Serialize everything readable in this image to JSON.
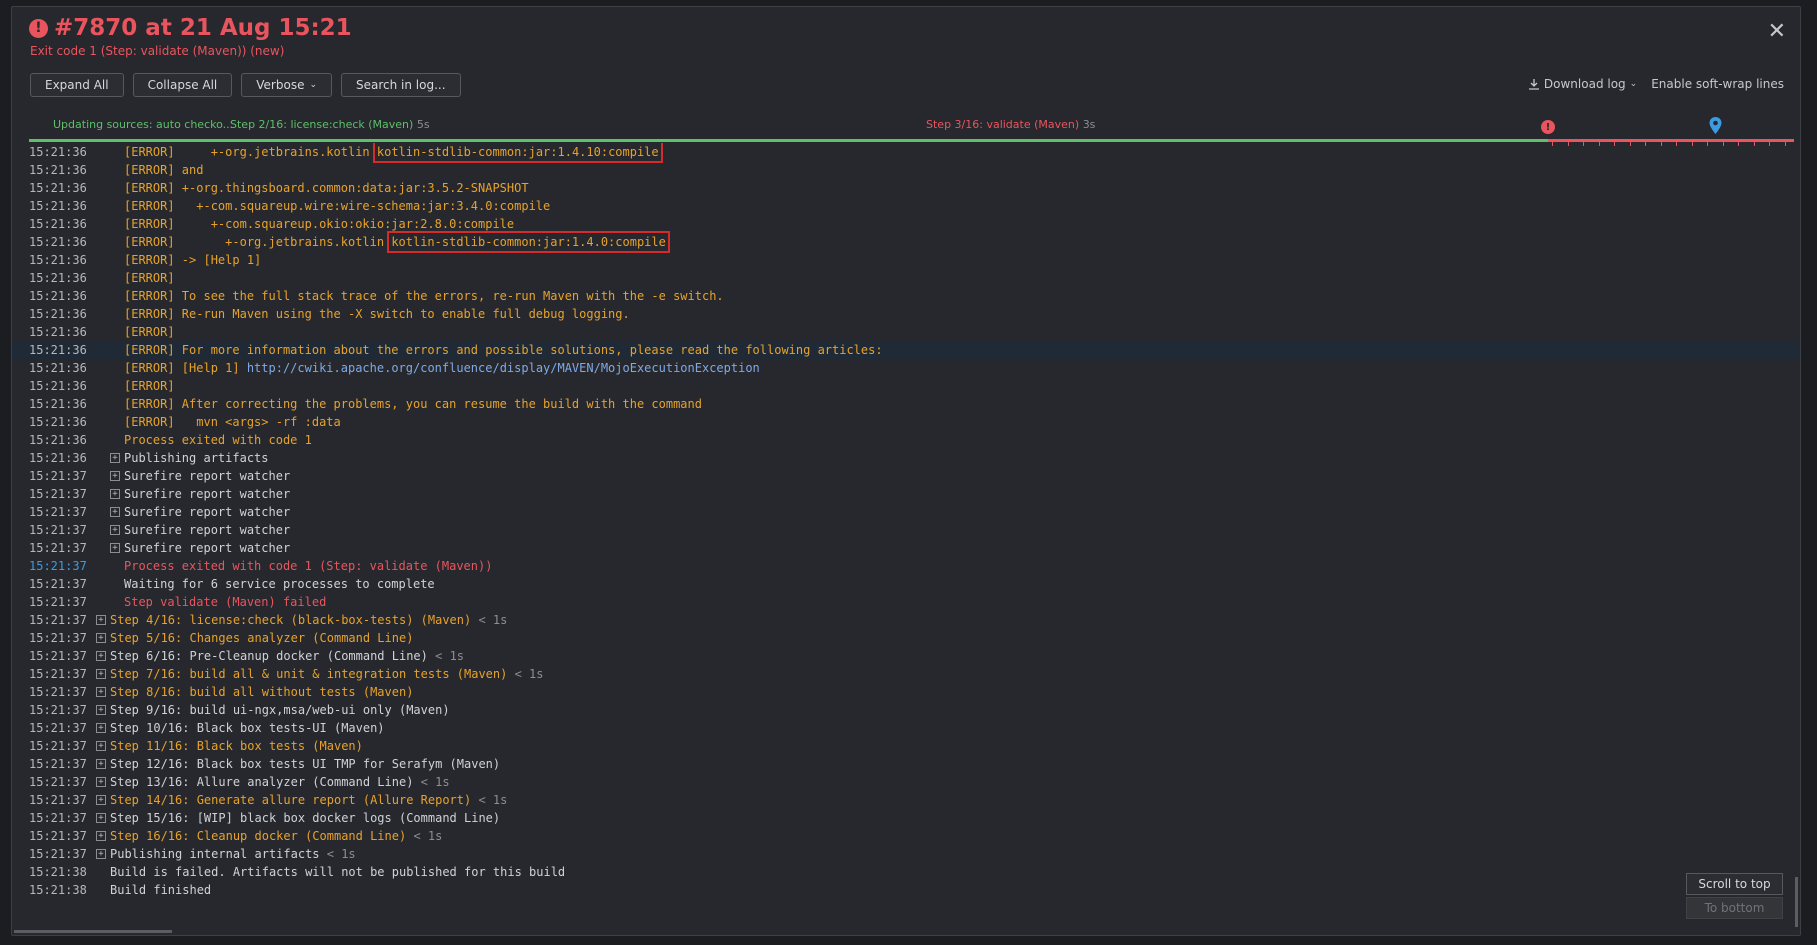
{
  "header": {
    "title": "#7870 at 21 Aug 15:21",
    "subtitle": "Exit code 1 (Step: validate (Maven)) (new)",
    "close": "✕"
  },
  "toolbar": {
    "expand_all": "Expand All",
    "collapse_all": "Collapse All",
    "verbose": "Verbose",
    "search": "Search in log...",
    "download_log": "Download log",
    "soft_wrap": "Enable soft-wrap lines"
  },
  "timeline": {
    "step1": "Updating sources: auto checko...",
    "step2": "Step 2/16: license:check (Maven)",
    "step2_dur": "5s",
    "step3": "Step 3/16: validate (Maven)",
    "step3_dur": "3s"
  },
  "log": [
    {
      "ts": "15:21:36",
      "parts": [
        {
          "t": "[ERROR]     +-org.jetbrains.kotlin ",
          "c": "err"
        },
        {
          "t": "kotlin-stdlib-common:jar:1.4.10:compile",
          "c": "err",
          "box": true
        }
      ]
    },
    {
      "ts": "15:21:36",
      "parts": [
        {
          "t": "[ERROR] and",
          "c": "err"
        }
      ]
    },
    {
      "ts": "15:21:36",
      "parts": [
        {
          "t": "[ERROR] +-org.thingsboard.common:data:jar:3.5.2-SNAPSHOT",
          "c": "err"
        }
      ]
    },
    {
      "ts": "15:21:36",
      "parts": [
        {
          "t": "[ERROR]   +-com.squareup.wire:wire-schema:jar:3.4.0:compile",
          "c": "err"
        }
      ]
    },
    {
      "ts": "15:21:36",
      "parts": [
        {
          "t": "[ERROR]     +-com.squareup.okio:okio:jar:2.8.0:compile",
          "c": "err"
        }
      ]
    },
    {
      "ts": "15:21:36",
      "parts": [
        {
          "t": "[ERROR]       +-org.jetbrains.kotlin ",
          "c": "err"
        },
        {
          "t": "kotlin-stdlib-common:jar:1.4.0:compile",
          "c": "err",
          "box": true
        }
      ]
    },
    {
      "ts": "15:21:36",
      "parts": [
        {
          "t": "[ERROR] -> [Help 1]",
          "c": "err"
        }
      ]
    },
    {
      "ts": "15:21:36",
      "parts": [
        {
          "t": "[ERROR]",
          "c": "err"
        }
      ]
    },
    {
      "ts": "15:21:36",
      "parts": [
        {
          "t": "[ERROR] To see the full stack trace of the errors, re-run Maven with the -e switch.",
          "c": "err"
        }
      ]
    },
    {
      "ts": "15:21:36",
      "parts": [
        {
          "t": "[ERROR] Re-run Maven using the -X switch to enable full debug logging.",
          "c": "err"
        }
      ]
    },
    {
      "ts": "15:21:36",
      "parts": [
        {
          "t": "[ERROR]",
          "c": "err"
        }
      ]
    },
    {
      "ts": "15:21:36",
      "hl": true,
      "parts": [
        {
          "t": "[ERROR] For more information about the errors and possible solutions, please read the following articles:",
          "c": "err"
        }
      ]
    },
    {
      "ts": "15:21:36",
      "parts": [
        {
          "t": "[ERROR] [Help 1] ",
          "c": "err"
        },
        {
          "t": "http://cwiki.apache.org/confluence/display/MAVEN/MojoExecutionException",
          "c": "lnk"
        }
      ]
    },
    {
      "ts": "15:21:36",
      "parts": [
        {
          "t": "[ERROR]",
          "c": "err"
        }
      ]
    },
    {
      "ts": "15:21:36",
      "parts": [
        {
          "t": "[ERROR] After correcting the problems, you can resume the build with the command",
          "c": "err"
        }
      ]
    },
    {
      "ts": "15:21:36",
      "parts": [
        {
          "t": "[ERROR]   mvn <args> -rf :data",
          "c": "err"
        }
      ]
    },
    {
      "ts": "15:21:36",
      "parts": [
        {
          "t": "Process exited with code 1",
          "c": "err"
        }
      ]
    },
    {
      "ts": "15:21:36",
      "exp": 1,
      "parts": [
        {
          "t": "Publishing artifacts",
          "c": "txt"
        }
      ]
    },
    {
      "ts": "15:21:37",
      "exp": 1,
      "parts": [
        {
          "t": "Surefire report watcher",
          "c": "txt"
        }
      ]
    },
    {
      "ts": "15:21:37",
      "exp": 1,
      "parts": [
        {
          "t": "Surefire report watcher",
          "c": "txt"
        }
      ]
    },
    {
      "ts": "15:21:37",
      "exp": 1,
      "parts": [
        {
          "t": "Surefire report watcher",
          "c": "txt"
        }
      ]
    },
    {
      "ts": "15:21:37",
      "exp": 1,
      "parts": [
        {
          "t": "Surefire report watcher",
          "c": "txt"
        }
      ]
    },
    {
      "ts": "15:21:37",
      "exp": 1,
      "parts": [
        {
          "t": "Surefire report watcher",
          "c": "txt"
        }
      ]
    },
    {
      "ts": "15:21:37",
      "blue": true,
      "parts": [
        {
          "t": "Process exited with code 1 (Step: validate (Maven))",
          "c": "redt"
        }
      ]
    },
    {
      "ts": "15:21:37",
      "parts": [
        {
          "t": "Waiting for 6 service processes to complete",
          "c": "txt"
        }
      ]
    },
    {
      "ts": "15:21:37",
      "parts": [
        {
          "t": "Step validate (Maven) failed",
          "c": "redt"
        }
      ]
    },
    {
      "ts": "15:21:37",
      "exp": 2,
      "parts": [
        {
          "t": "Step 4/16: license:check (black-box-tests) (Maven)",
          "c": "err"
        },
        {
          "t": " < 1s",
          "c": "gray"
        }
      ]
    },
    {
      "ts": "15:21:37",
      "exp": 2,
      "parts": [
        {
          "t": "Step 5/16: Changes analyzer (Command Line)",
          "c": "err"
        }
      ]
    },
    {
      "ts": "15:21:37",
      "exp": 2,
      "parts": [
        {
          "t": "Step 6/16: Pre-Cleanup docker (Command Line)",
          "c": "txt"
        },
        {
          "t": " < 1s",
          "c": "gray"
        }
      ]
    },
    {
      "ts": "15:21:37",
      "exp": 2,
      "parts": [
        {
          "t": "Step 7/16: build all & unit & integration tests (Maven)",
          "c": "err"
        },
        {
          "t": " < 1s",
          "c": "gray"
        }
      ]
    },
    {
      "ts": "15:21:37",
      "exp": 2,
      "parts": [
        {
          "t": "Step 8/16: build all without tests (Maven)",
          "c": "err"
        }
      ]
    },
    {
      "ts": "15:21:37",
      "exp": 2,
      "parts": [
        {
          "t": "Step 9/16: build ui-ngx,msa/web-ui only (Maven)",
          "c": "txt"
        }
      ]
    },
    {
      "ts": "15:21:37",
      "exp": 2,
      "parts": [
        {
          "t": "Step 10/16: Black box tests-UI (Maven)",
          "c": "txt"
        }
      ]
    },
    {
      "ts": "15:21:37",
      "exp": 2,
      "parts": [
        {
          "t": "Step 11/16: Black box tests (Maven)",
          "c": "err"
        }
      ]
    },
    {
      "ts": "15:21:37",
      "exp": 2,
      "parts": [
        {
          "t": "Step 12/16: Black box tests UI TMP for Serafym (Maven)",
          "c": "txt"
        }
      ]
    },
    {
      "ts": "15:21:37",
      "exp": 2,
      "parts": [
        {
          "t": "Step 13/16: Allure analyzer (Command Line)",
          "c": "txt"
        },
        {
          "t": " < 1s",
          "c": "gray"
        }
      ]
    },
    {
      "ts": "15:21:37",
      "exp": 2,
      "parts": [
        {
          "t": "Step 14/16: Generate allure report (Allure Report)",
          "c": "err"
        },
        {
          "t": " < 1s",
          "c": "gray"
        }
      ]
    },
    {
      "ts": "15:21:37",
      "exp": 2,
      "parts": [
        {
          "t": "Step 15/16: [WIP] black box docker logs (Command Line)",
          "c": "txt"
        }
      ]
    },
    {
      "ts": "15:21:37",
      "exp": 2,
      "parts": [
        {
          "t": "Step 16/16: Cleanup docker (Command Line)",
          "c": "err"
        },
        {
          "t": " < 1s",
          "c": "gray"
        }
      ]
    },
    {
      "ts": "15:21:37",
      "exp": 2,
      "parts": [
        {
          "t": "Publishing internal artifacts",
          "c": "txt"
        },
        {
          "t": " < 1s",
          "c": "gray"
        }
      ]
    },
    {
      "ts": "15:21:38",
      "lvl2": true,
      "parts": [
        {
          "t": "Build is failed. Artifacts will not be published for this build",
          "c": "txt"
        }
      ]
    },
    {
      "ts": "15:21:38",
      "lvl2": true,
      "parts": [
        {
          "t": "Build finished",
          "c": "txt"
        }
      ]
    }
  ],
  "scroll": {
    "top": "Scroll to top",
    "bottom": "To bottom"
  },
  "colors": {
    "error": "#e8a22a",
    "failure": "#e9555e",
    "success": "#5fbf6a",
    "link": "#7fa9e6"
  }
}
